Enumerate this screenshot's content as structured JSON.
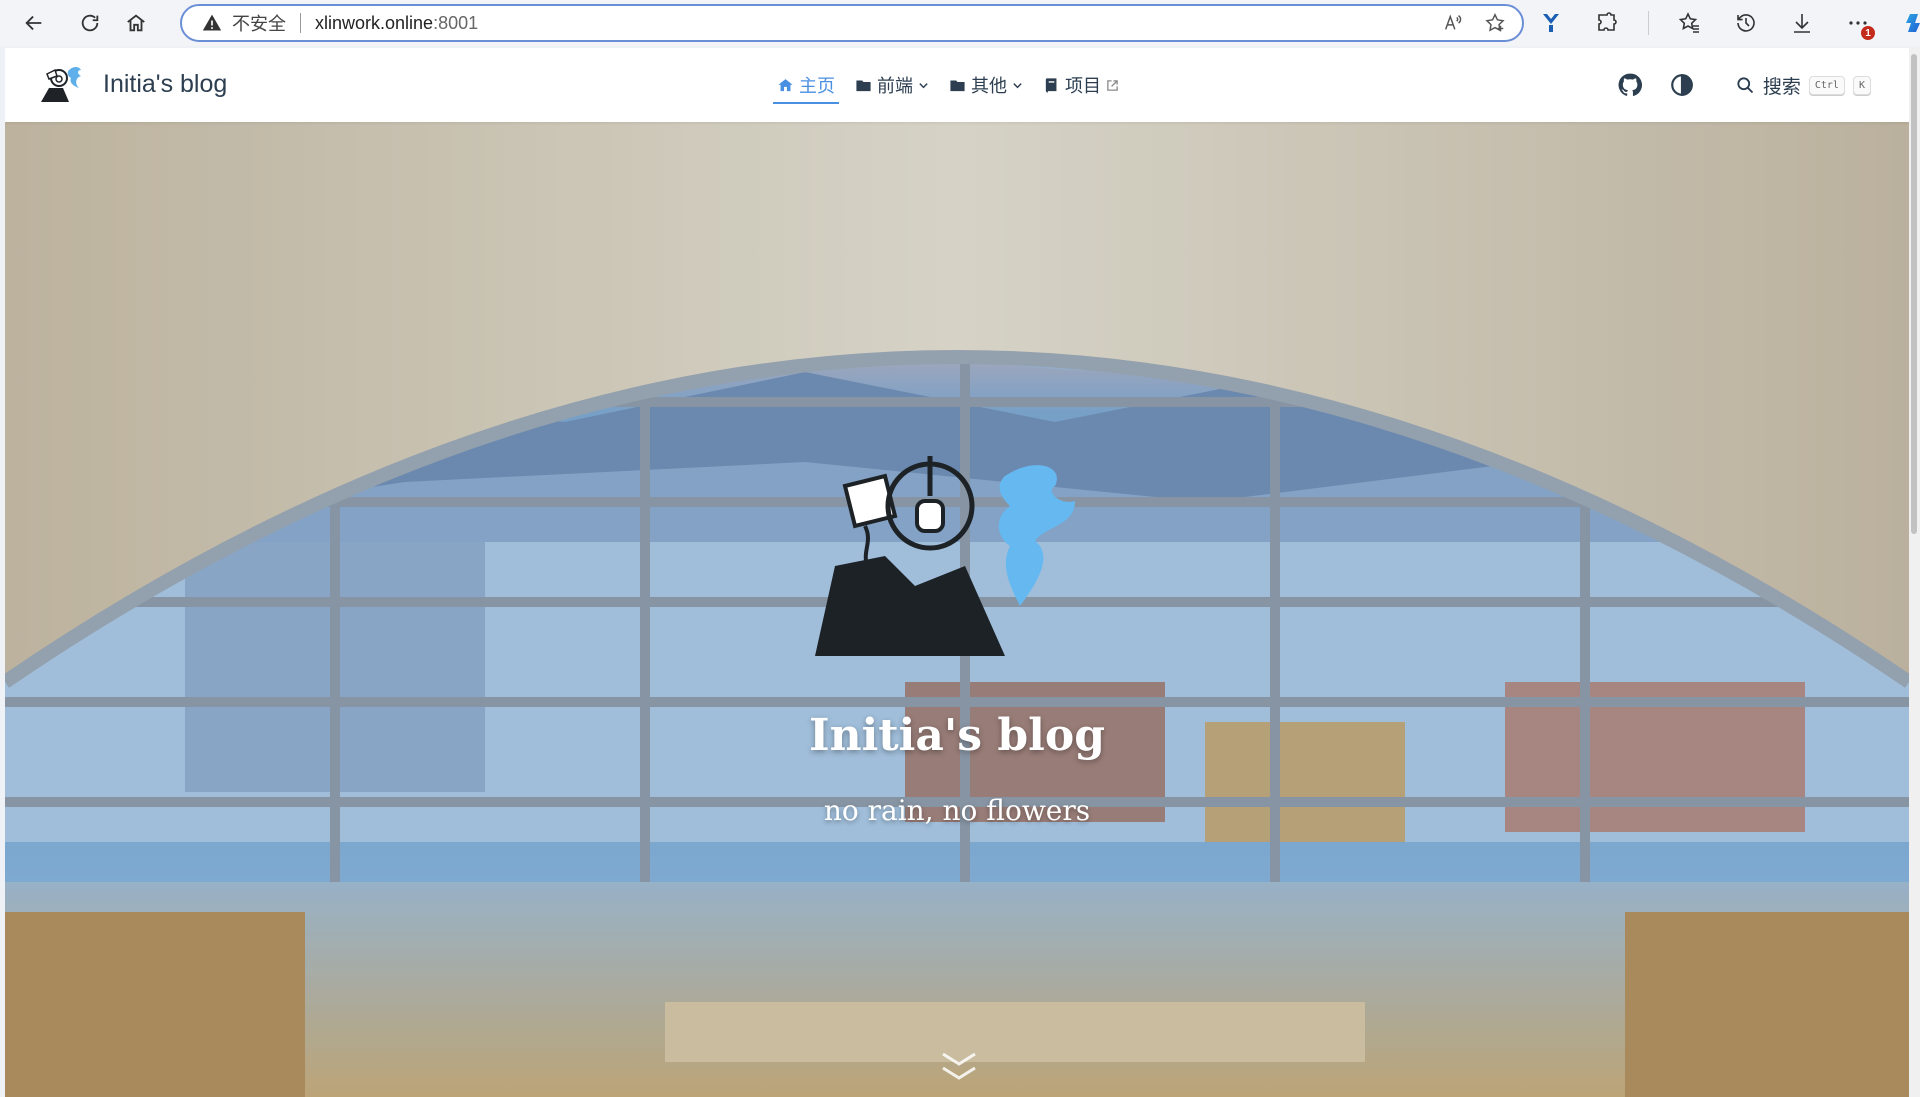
{
  "browser": {
    "insecure_label": "不安全",
    "url_host": "xlinwork.online",
    "url_port": ":8001",
    "notification_count": "1",
    "icons": [
      "back-icon",
      "refresh-icon",
      "home-icon",
      "warning-icon",
      "read-aloud-icon",
      "favorite-star-icon",
      "extension-y-icon",
      "extensions-icon",
      "favorites-icon",
      "history-icon",
      "download-icon",
      "more-icon",
      "copilot-icon"
    ]
  },
  "site": {
    "brand_title": "Initia's blog",
    "nav": [
      {
        "label": "主页",
        "icon": "home-icon",
        "active": true
      },
      {
        "label": "前端",
        "icon": "folder-icon",
        "dropdown": true
      },
      {
        "label": "其他",
        "icon": "folder-icon",
        "dropdown": true
      },
      {
        "label": "项目",
        "icon": "book-icon",
        "external": true
      }
    ],
    "search_label": "搜索",
    "search_key_1": "Ctrl",
    "search_key_2": "K"
  },
  "hero": {
    "title": "Initia's blog",
    "subtitle": "no rain, no flowers"
  },
  "colors": {
    "accent": "#4a90e2",
    "text": "#2c3e50"
  }
}
